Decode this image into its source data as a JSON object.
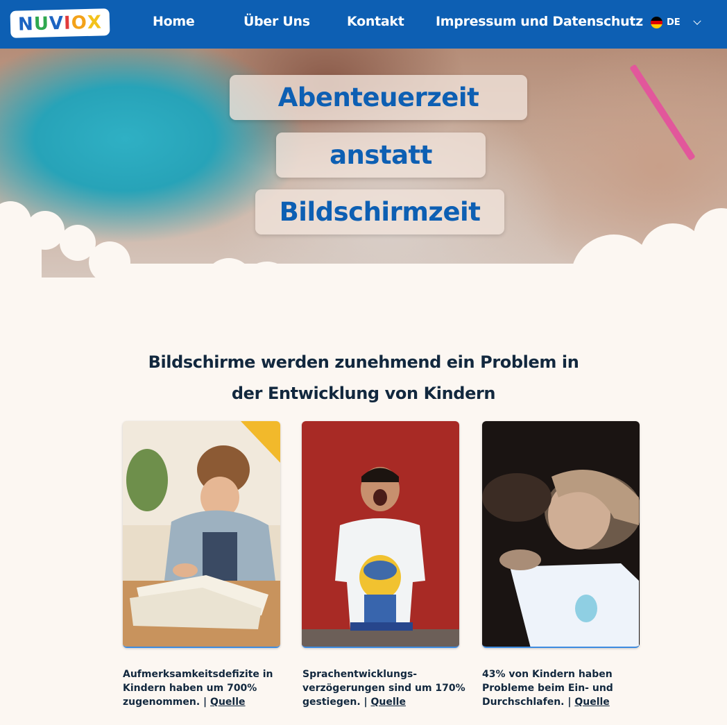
{
  "header": {
    "logo_text": "NUVIOX",
    "nav": [
      "Home",
      "Über Uns",
      "Kontakt",
      "Impressum und Datenschutz"
    ],
    "language": "DE"
  },
  "hero": {
    "lines": [
      "Abenteuerzeit",
      "anstatt",
      "Bildschirmzeit"
    ]
  },
  "section": {
    "title_line1": "Bildschirme werden zunehmend ein Problem in",
    "title_line2": "der Entwicklung von Kindern"
  },
  "cards": [
    {
      "text": "Aufmerksamkeitsdefizite in Kindern haben um 700% zugenommen. | ",
      "link": "Quelle"
    },
    {
      "text": "Sprachentwicklungs-verzögerungen sind um 170% gestiegen. | ",
      "link": "Quelle"
    },
    {
      "text": "43% von Kindern haben Probleme beim Ein- und Durchschlafen. | ",
      "link": "Quelle"
    }
  ],
  "colors": {
    "header_bg": "#0d5fb3",
    "hero_text": "#0d5fb3",
    "page_bg": "#fcf7f2",
    "heading_text": "#12283e"
  }
}
